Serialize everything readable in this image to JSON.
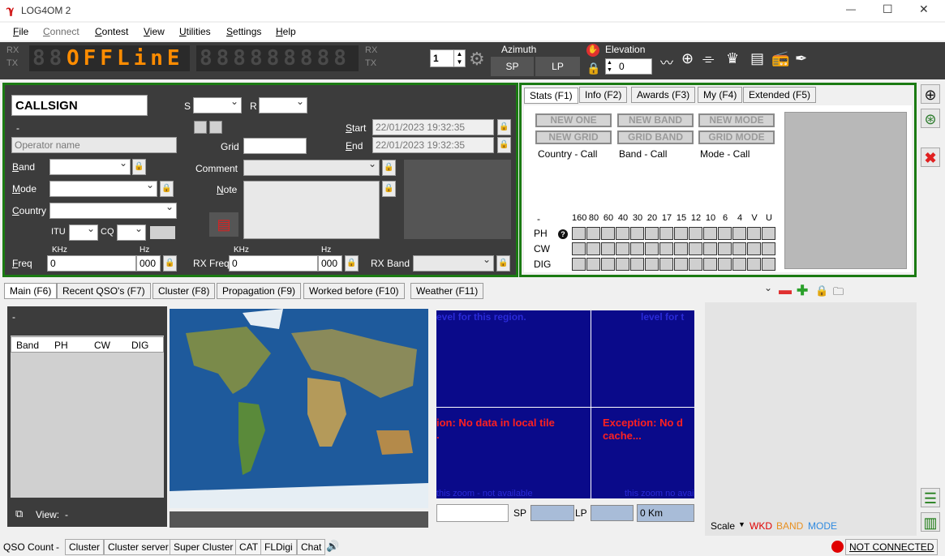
{
  "app": {
    "title": "LOG4OM 2"
  },
  "window_controls": {
    "minimize": "—",
    "maximize": "☐",
    "close": "✕"
  },
  "menu": [
    "File",
    "Connect",
    "Contest",
    "View",
    "Utilities",
    "Settings",
    "Help"
  ],
  "ribbon": {
    "rx_label": "RX",
    "tx_label": "TX",
    "rx_label_right": "RX",
    "tx_label_right": "TX",
    "display_text": "OFFLinE",
    "display_ghost": "88",
    "freq_ghost": "888888888",
    "radio_number": "1",
    "azimuth_label": "Azimuth",
    "sp_button": "SP",
    "lp_button": "LP",
    "elevation_label": "Elevation",
    "elevation_value": "0"
  },
  "qso": {
    "callsign_placeholder": "CALLSIGN",
    "name_dash": "-",
    "operator_placeholder": "Operator name",
    "s_label": "S",
    "r_label": "R",
    "start_label": "Start",
    "start_value": "22/01/2023 19:32:35",
    "end_label": "End",
    "end_value": "22/01/2023 19:32:35",
    "grid_label": "Grid",
    "band_label": "Band",
    "comment_label": "Comment",
    "mode_label": "Mode",
    "note_label": "Note",
    "country_label": "Country",
    "itu_label": "ITU",
    "cq_label": "CQ",
    "khz_label": "KHz",
    "hz_label": "Hz",
    "freq_label": "Freq",
    "freq_value": "0",
    "freq_hz_value": "000",
    "rx_freq_label": "RX Freq",
    "rx_freq_value": "0",
    "rx_freq_hz_value": "000",
    "rx_band_label": "RX Band"
  },
  "stats": {
    "tabs": [
      "Stats (F1)",
      "Info (F2)",
      "Awards (F3)",
      "My (F4)",
      "Extended (F5)"
    ],
    "buttons": [
      "NEW ONE",
      "NEW BAND",
      "NEW MODE",
      "NEW GRID",
      "GRID BAND",
      "GRID MODE"
    ],
    "captions": [
      "Country - Call",
      "Band - Call",
      "Mode - Call"
    ],
    "dash": "-",
    "bands": [
      "160",
      "80",
      "60",
      "40",
      "30",
      "20",
      "17",
      "15",
      "12",
      "10",
      "6",
      "4",
      "V",
      "U"
    ],
    "rows": [
      "PH",
      "CW",
      "DIG"
    ],
    "help_icon": "?"
  },
  "main_tabs": [
    "Main (F6)",
    "Recent QSO's (F7)",
    "Cluster (F8)",
    "Propagation (F9)",
    "Worked before (F10)",
    "Weather (F11)"
  ],
  "worked_table": {
    "dash": "-",
    "headers": [
      "Band",
      "PH",
      "CW",
      "DIG"
    ],
    "view_label": "View:",
    "view_value": "-"
  },
  "map_panel": {
    "top_text_left": "evel for this region.",
    "top_text_right": "level for t",
    "error_left_1": "ion: No data in local tile",
    "error_left_2": ".",
    "error_right_1": "Exception: No d",
    "error_right_2": "cache...",
    "bottom_text_left": "this zoom - not available",
    "bottom_text_right": "this zoom no avail",
    "sp_label": "SP",
    "lp_label": "LP",
    "distance": "0 Km"
  },
  "right_panel": {
    "scale_label": "Scale",
    "wkd": "WKD",
    "band": "BAND",
    "mode": "MODE"
  },
  "status_bar": {
    "qso_count": "QSO Count",
    "qso_count_value": "-",
    "items": [
      "Cluster",
      "Cluster server",
      "Super Cluster",
      "CAT",
      "FLDigi",
      "Chat"
    ],
    "not_connected": "NOT CONNECTED"
  },
  "colors": {
    "panel_bg": "#3c3c3c",
    "panel_border": "#1a7a12",
    "display_orange": "#ff8c00",
    "map_bg": "#0a0a8a",
    "error_red": "#ff2020",
    "wkd": "#e00000",
    "band": "#e89020",
    "mode": "#2f8ae0"
  }
}
